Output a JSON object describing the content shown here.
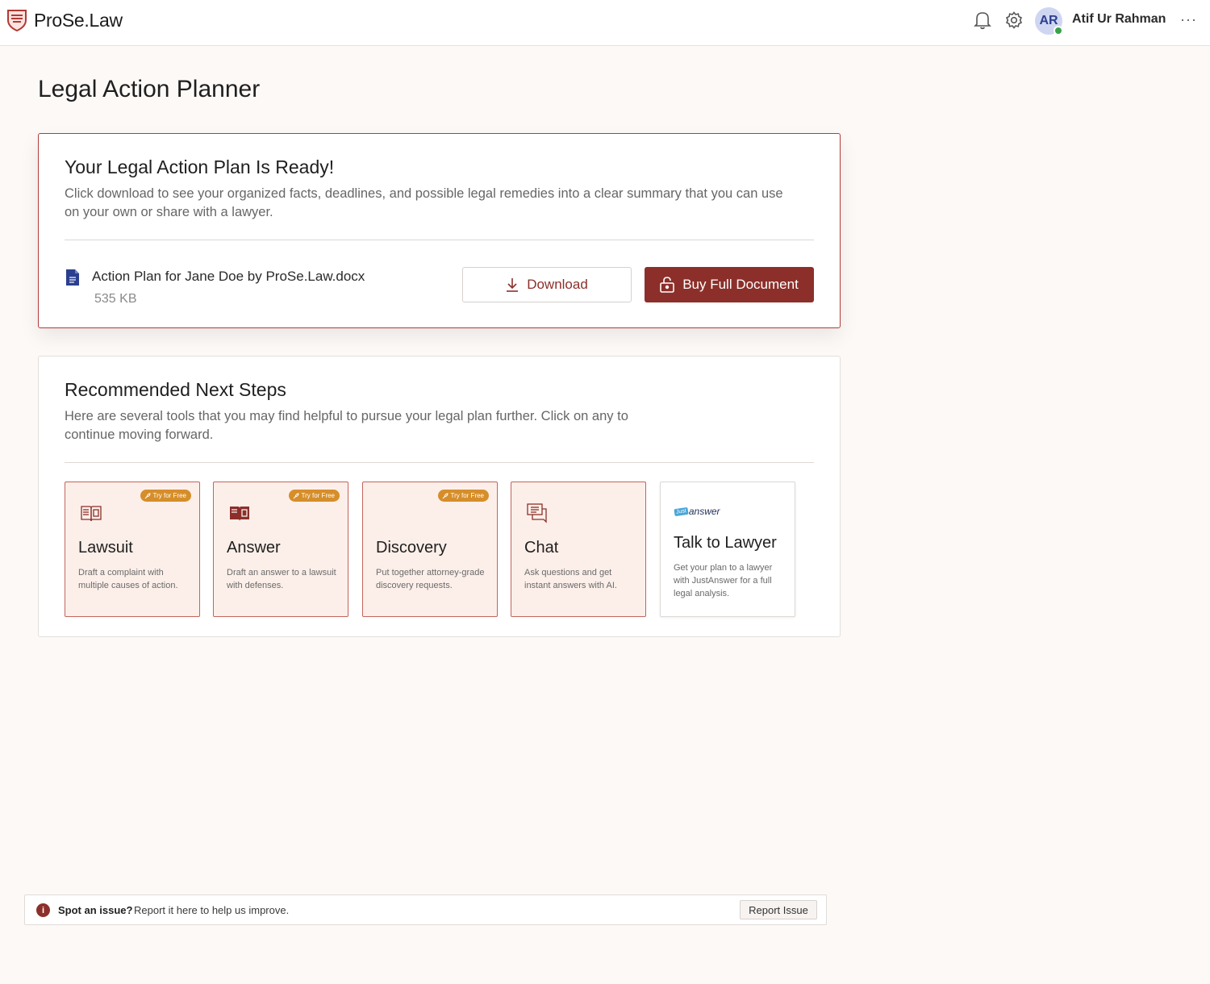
{
  "brand": {
    "name": "ProSe.Law"
  },
  "header": {
    "user_initials": "AR",
    "user_name": "Atif Ur Rahman",
    "more": "···"
  },
  "page": {
    "title": "Legal Action Planner"
  },
  "ready": {
    "title": "Your Legal Action Plan Is Ready!",
    "description": "Click download to see your organized facts, deadlines, and possible legal remedies into a clear summary that you can use on your own or share with a lawyer.",
    "file_name": "Action Plan for Jane Doe by ProSe.Law.docx",
    "file_size": "535 KB",
    "download_label": "Download",
    "buy_label": "Buy Full Document"
  },
  "steps": {
    "title": "Recommended Next Steps",
    "description": "Here are several tools that you may find helpful to pursue your legal plan further.  Click on any to continue moving forward.",
    "badge_label": "Try for Free",
    "tiles": [
      {
        "title": "Lawsuit",
        "desc": "Draft a complaint with multiple causes of action."
      },
      {
        "title": "Answer",
        "desc": "Draft an answer to a lawsuit with defenses."
      },
      {
        "title": "Discovery",
        "desc": "Put together attorney-grade discovery requests."
      },
      {
        "title": "Chat",
        "desc": "Ask questions and get instant answers with AI."
      },
      {
        "title": "Talk to Lawyer",
        "desc": "Get your plan to a lawyer with JustAnswer for a full legal analysis.",
        "logo_small": "Just",
        "logo_main": "answer"
      }
    ]
  },
  "issue": {
    "strong": "Spot an issue?",
    "text": "Report it here to help us improve.",
    "button": "Report Issue",
    "icon": "i"
  },
  "colors": {
    "accent": "#8c2f2a",
    "badge": "#d68e2a",
    "tile_bg": "#fcefe9"
  }
}
